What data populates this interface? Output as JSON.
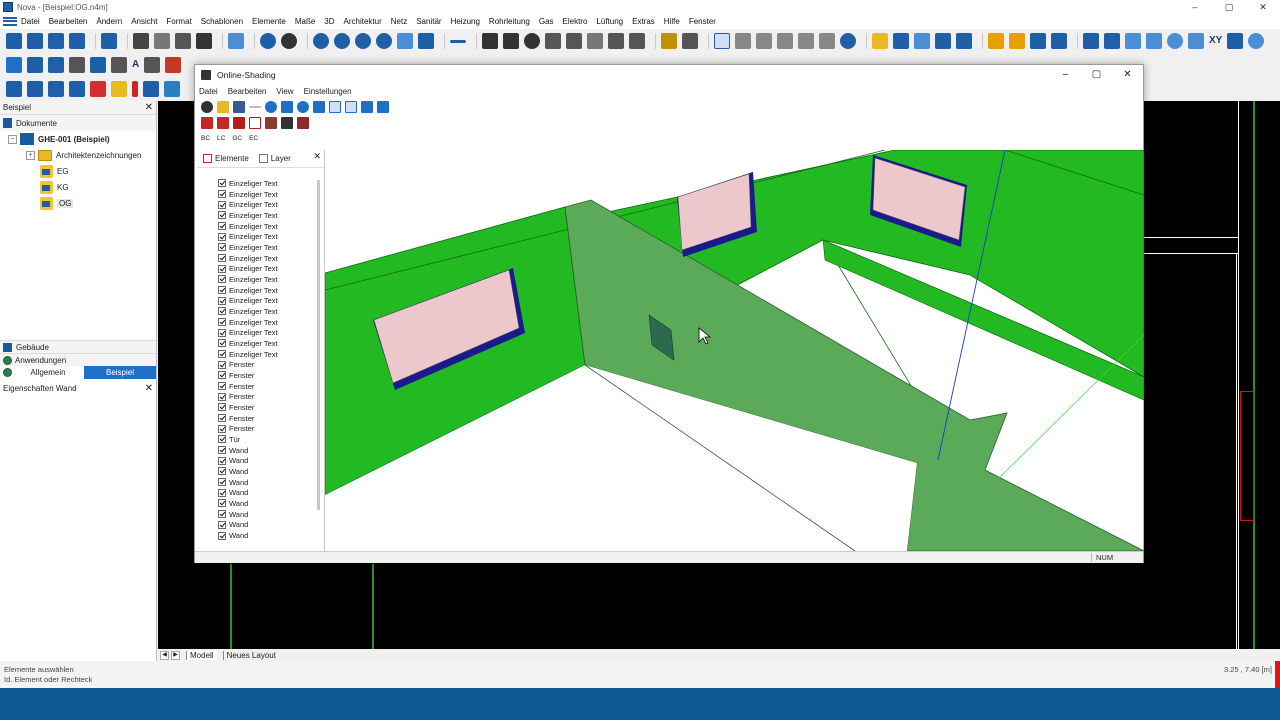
{
  "app": {
    "title": "Nova - [Beispiel:OG.n4m]",
    "controls": [
      "–",
      "▢",
      "✕"
    ]
  },
  "menu": [
    "Datei",
    "Bearbeiten",
    "Ändern",
    "Ansicht",
    "Format",
    "Schablonen",
    "Elemente",
    "Maße",
    "3D",
    "Architektur",
    "Netz",
    "Sanitär",
    "Heizung",
    "Rohrleitung",
    "Gas",
    "Elektro",
    "Lüftung",
    "Extras",
    "Hilfe",
    "Fenster"
  ],
  "toolbar": {
    "xyz_label": "XY"
  },
  "left_panel": {
    "title": "Beispiel",
    "tree": {
      "root": "Dokumente",
      "project": "GHE-001 (Beispiel)",
      "folder": "Architektenzeichnungen",
      "levels": [
        "EG",
        "KG",
        "OG"
      ]
    },
    "sections": [
      "Gebäude",
      "Anwendungen"
    ],
    "tabs": [
      "Allgemein",
      "Beispiel"
    ],
    "properties_title": "Eigenschaften Wand"
  },
  "bottom_tabs": [
    "Modell",
    "Neues Layout"
  ],
  "status": {
    "line1": "Elemente auswählen",
    "line2": "Id. Element oder Rechteck",
    "coords": "3.25 , 7.40 [m]"
  },
  "dialog": {
    "title": "Online-Shading",
    "menu": [
      "Datei",
      "Bearbeiten",
      "View",
      "Einstellungen"
    ],
    "text_buttons": [
      "BC",
      "LC",
      "GC",
      "EC"
    ],
    "tabs": [
      "Elemente",
      "Layer"
    ],
    "elements": [
      "Einzeliger Text",
      "Einzeliger Text",
      "Einzeliger Text",
      "Einzeliger Text",
      "Einzeliger Text",
      "Einzeliger Text",
      "Einzeliger Text",
      "Einzeliger Text",
      "Einzeliger Text",
      "Einzeliger Text",
      "Einzeliger Text",
      "Einzeliger Text",
      "Einzeliger Text",
      "Einzeliger Text",
      "Einzeliger Text",
      "Einzeliger Text",
      "Einzeliger Text",
      "Fenster",
      "Fenster",
      "Fenster",
      "Fenster",
      "Fenster",
      "Fenster",
      "Fenster",
      "Tür",
      "Wand",
      "Wand",
      "Wand",
      "Wand",
      "Wand",
      "Wand",
      "Wand",
      "Wand",
      "Wand"
    ],
    "status_num": "NUM"
  },
  "colors": {
    "wall_green": "#22b922",
    "wall_selected": "#5aaa5a",
    "window_glass": "#ecc8cc",
    "window_frame": "#1a1a8c",
    "accent": "#1f6fc6",
    "taskbar": "#0d5a96"
  }
}
